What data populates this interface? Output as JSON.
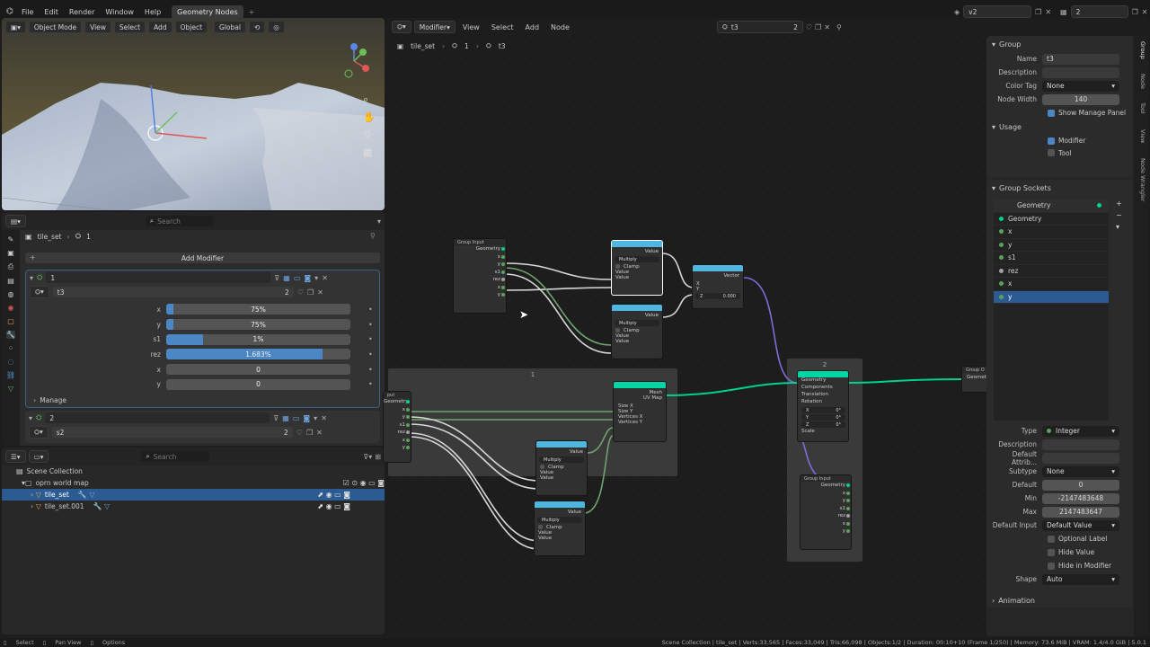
{
  "topbar": {
    "menus": [
      "File",
      "Edit",
      "Render",
      "Window",
      "Help"
    ],
    "workspace_tab": "Geometry Nodes",
    "scene_name": "v2",
    "view_layer_num": "2"
  },
  "viewport": {
    "mode": "Object Mode",
    "menus": [
      "View",
      "Select",
      "Add",
      "Object"
    ],
    "transform": "Global"
  },
  "properties": {
    "search_placeholder": "Search",
    "breadcrumb_object": "tile_set",
    "breadcrumb_modifier": "1",
    "add_modifier": "Add Modifier",
    "modifiers": [
      {
        "name": "1",
        "group": "t3",
        "users": "2",
        "inputs": [
          {
            "label": "x",
            "value": "75%",
            "fill": 0.04
          },
          {
            "label": "y",
            "value": "75%",
            "fill": 0.04
          },
          {
            "label": "s1",
            "value": "1%",
            "fill": 0.2
          },
          {
            "label": "rez",
            "value": "1.683%",
            "fill": 0.85
          },
          {
            "label": "x",
            "value": "0",
            "fill": 0
          },
          {
            "label": "y",
            "value": "0",
            "fill": 0
          }
        ],
        "manage": "Manage"
      },
      {
        "name": "2",
        "group": "s2",
        "users": "2"
      }
    ]
  },
  "outliner": {
    "search_placeholder": "Search",
    "root": "Scene Collection",
    "collection": "oprn world map",
    "items": [
      "tile_set",
      "tile_set.001"
    ]
  },
  "node_editor": {
    "menus": [
      "Modifier",
      "View",
      "Select",
      "Add",
      "Node"
    ],
    "group_name": "t3",
    "group_users": "2",
    "breadcrumb": [
      "tile_set",
      "1",
      "t3"
    ],
    "frame1_label": "1",
    "frame2_label": "2",
    "nodes": {
      "group_input_a": {
        "title": "Group Input",
        "sockets": [
          "Geometry",
          "x",
          "y",
          "s1",
          "rez",
          "x",
          "y"
        ]
      },
      "math1": {
        "out": "Value",
        "op": "Multiply",
        "clamp": "Clamp",
        "in": [
          "Value",
          "Value"
        ]
      },
      "math2": {
        "out": "Value",
        "op": "Multiply",
        "clamp": "Clamp",
        "in": [
          "Value",
          "Value"
        ]
      },
      "combine": {
        "out": "Vector",
        "in": [
          "X",
          "Y",
          "Z"
        ],
        "z_value": "0.000"
      },
      "grid": {
        "outs": [
          "Mesh",
          "UV Map"
        ],
        "ins": [
          "Size X",
          "Size Y",
          "Vertices X",
          "Vertices Y"
        ]
      },
      "group_input_b": {
        "sockets": [
          "Geometry",
          "x",
          "y",
          "s1",
          "rez",
          "x",
          "y"
        ]
      },
      "math3": {
        "out": "Value",
        "op": "Multiply",
        "clamp": "Clamp",
        "in": [
          "Value",
          "Value"
        ]
      },
      "math4": {
        "out": "Value",
        "op": "Multiply",
        "clamp": "Clamp",
        "in": [
          "Value",
          "Value"
        ]
      },
      "transform": {
        "sockets": [
          "Geometry",
          "Components",
          "Translation",
          "Rotation",
          "Scale"
        ],
        "xyz": [
          "X",
          "Y",
          "Z"
        ],
        "vals": [
          "0°",
          "0°",
          "0°"
        ]
      },
      "group_input_c": {
        "title": "Group Input",
        "sockets": [
          "Geometry",
          "x",
          "y",
          "s1",
          "rez",
          "x",
          "y"
        ]
      },
      "group_output": {
        "title": "Group O",
        "sockets": [
          "Geometry"
        ]
      }
    }
  },
  "sidebar": {
    "group_title": "Group",
    "name_label": "Name",
    "name_value": "t3",
    "desc_label": "Description",
    "color_tag_label": "Color Tag",
    "color_tag_value": "None",
    "node_width_label": "Node Width",
    "node_width_value": "140",
    "show_manage": "Show Manage Panel",
    "usage_title": "Usage",
    "usage_modifier": "Modifier",
    "usage_tool": "Tool",
    "sockets_title": "Group Sockets",
    "sockets": [
      {
        "name": "Geometry",
        "color": "#00d18c",
        "header": true
      },
      {
        "name": "Geometry",
        "color": "#00d18c"
      },
      {
        "name": "x",
        "color": "#5ca05c"
      },
      {
        "name": "y",
        "color": "#5ca05c"
      },
      {
        "name": "s1",
        "color": "#5ca05c"
      },
      {
        "name": "rez",
        "color": "#a0a0a0"
      },
      {
        "name": "x",
        "color": "#5ca05c"
      },
      {
        "name": "y",
        "color": "#5ca05c",
        "selected": true
      }
    ],
    "type_label": "Type",
    "type_value": "Integer",
    "desc2_label": "Description",
    "default_attr_label": "Default Attrib...",
    "subtype_label": "Subtype",
    "subtype_value": "None",
    "default_label": "Default",
    "default_value": "0",
    "min_label": "Min",
    "min_value": "-2147483648",
    "max_label": "Max",
    "max_value": "2147483647",
    "default_input_label": "Default Input",
    "default_input_value": "Default Value",
    "optional_label": "Optional Label",
    "hide_value": "Hide Value",
    "hide_in_modifier": "Hide in Modifier",
    "shape_label": "Shape",
    "shape_value": "Auto",
    "animation_title": "Animation",
    "tabs": [
      "Group",
      "Node",
      "Tool",
      "View",
      "Node Wrangler"
    ]
  },
  "statusbar": {
    "select": "Select",
    "pan": "Pan View",
    "options": "Options",
    "info": "Scene Collection | tile_set | Verts:33,565 | Faces:33,049 | Tris:66,098 | Objects:1/2 | Duration: 00:10+10 (Frame 1/250) | Memory: 73.6 MiB | VRAM: 1.4/4.0 GiB | 5.0.1"
  },
  "colors": {
    "accent": "#4a87c4",
    "geometry": "#00d18c",
    "math_header": "#4fb6e0",
    "bg": "#1d1d1d"
  }
}
